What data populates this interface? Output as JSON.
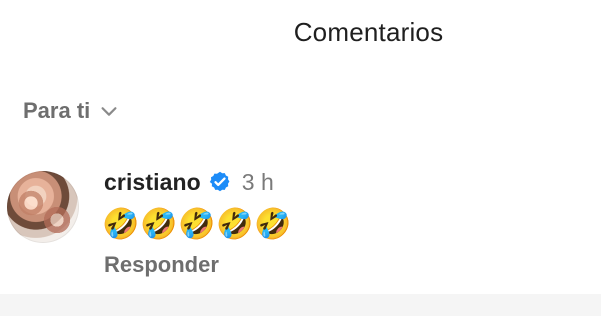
{
  "header": {
    "title": "Comentarios"
  },
  "filter": {
    "label": "Para ti",
    "icon": "chevron-down-icon"
  },
  "comment": {
    "username": "cristiano",
    "verified_icon": "verified-badge-icon",
    "time": "3 h",
    "emojis": [
      "🤣",
      "🤣",
      "🤣",
      "🤣",
      "🤣"
    ],
    "reply_label": "Responder"
  },
  "colors": {
    "text": "#1f1f1f",
    "muted": "#6e6e6e",
    "verified": "#1d8cf8",
    "bottom_strip": "#f5f5f5"
  }
}
